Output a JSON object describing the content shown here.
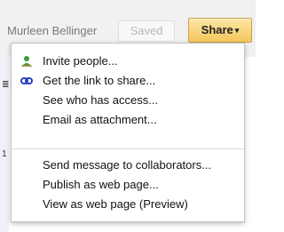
{
  "header": {
    "user_name": "Murleen Bellinger",
    "saved_label": "Saved",
    "share_label": "Share",
    "share_caret": "▾"
  },
  "share_menu": {
    "items": [
      {
        "label": "Invite people...",
        "icon": "invite-people-icon"
      },
      {
        "label": "Get the link to share...",
        "icon": "link-icon"
      },
      {
        "label": "See who has access...",
        "icon": ""
      },
      {
        "label": "Email as attachment...",
        "icon": ""
      },
      {
        "label": "Send message to collaborators...",
        "icon": ""
      },
      {
        "label": "Publish as web page...",
        "icon": ""
      },
      {
        "label": "View as web page (Preview)",
        "icon": ""
      }
    ]
  },
  "colors": {
    "share_button": "#f4c65c",
    "link_icon": "#2a3fbf",
    "invite_icon_green": "#3a9d3a",
    "invite_icon_orange": "#e6873a"
  }
}
